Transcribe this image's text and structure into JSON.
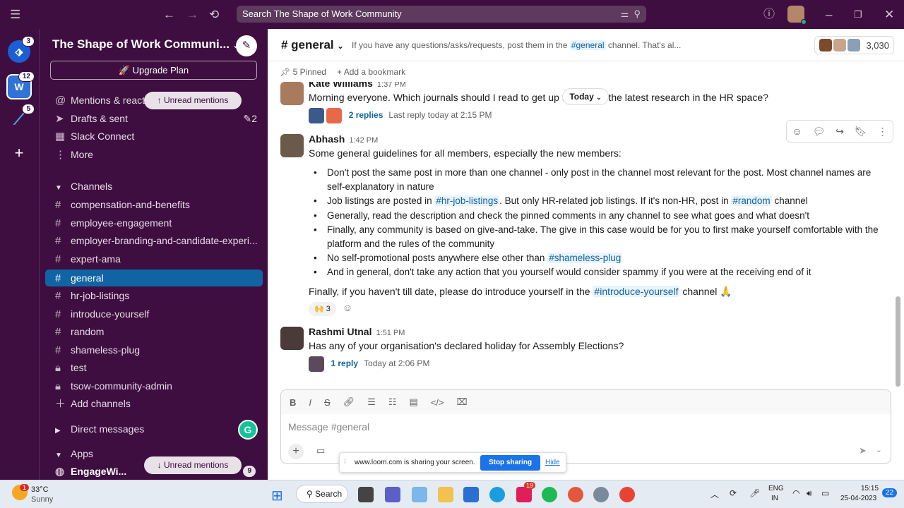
{
  "topbar": {
    "search_text": "Search The Shape of Work Community"
  },
  "workspace": {
    "name": "The Shape of Work Communi...",
    "upgrade": "Upgrade Plan"
  },
  "rail": {
    "badges": [
      "3",
      "12",
      "5"
    ]
  },
  "sidebar": {
    "nav": [
      {
        "label": "Mentions & reactions"
      },
      {
        "label": "Drafts & sent",
        "badge": "2"
      },
      {
        "label": "Slack Connect"
      },
      {
        "label": "More"
      }
    ],
    "unread_pill": "Unread mentions",
    "channels_header": "Channels",
    "channels": [
      "compensation-and-benefits",
      "employee-engagement",
      "employer-branding-and-candidate-experi...",
      "expert-ama",
      "general",
      "hr-job-listings",
      "introduce-yourself",
      "random",
      "shameless-plug",
      "test",
      "tsow-community-admin"
    ],
    "add_channels": "Add channels",
    "dms_header": "Direct messages",
    "apps_header": "Apps",
    "app_item": "EngageWi...",
    "app_badge": "9"
  },
  "channel": {
    "name": "# general",
    "topic_pre": "If you have any questions/asks/requests, post them in the",
    "topic_link": "#general",
    "topic_post": "channel. That's al...",
    "member_count": "3,030",
    "pinned": "5 Pinned",
    "bookmark": "Add a bookmark",
    "date_divider": "Today"
  },
  "messages": {
    "m1": {
      "author": "Kate Williams",
      "time": "1:37 PM",
      "text_a": "Morning everyone. Which journals should I read to get up to",
      "text_b": "the latest research in the HR space?",
      "replies": "2 replies",
      "last_reply": "Last reply today at 2:15 PM"
    },
    "m2": {
      "author": "Abhash",
      "time": "1:42 PM",
      "intro": "Some general guidelines for all members, especially the new members:",
      "b1": "Don't post the same post in more than one channel - only post in the channel most relevant for the post. Most channel names are self-explanatory in nature",
      "b2_pre": "Job listings are posted in",
      "b2_link": "#hr-job-listings",
      "b2_mid": ". But only HR-related job listings. If it's non-HR, post in",
      "b2_link2": "#random",
      "b2_post": "channel",
      "b3": " Generally, read the description and check the pinned comments in any channel to see what goes and what doesn't",
      "b4": " Finally, any community is based on give-and-take. The give in this case would be for you to first make yourself comfortable with the platform and the rules of the community",
      "b5_pre": "No self-promotional posts anywhere else other than",
      "b5_link": "#shameless-plug",
      "b6": "And in general, don't take any action that you yourself would consider spammy if you were at the receiving end of it",
      "outro_pre": "Finally, if you haven't till date, please do introduce yourself in the",
      "outro_link": "#introduce-yourself",
      "outro_post": "channel",
      "reaction_count": "3"
    },
    "m3": {
      "author": "Rashmi Utnal",
      "time": "1:51 PM",
      "text": "Has any of your organisation's declared holiday for Assembly Elections?",
      "replies": "1 reply",
      "last_reply": "Today at 2:06 PM"
    }
  },
  "composer": {
    "placeholder": "Message #general"
  },
  "loom": {
    "text": "www.loom.com is sharing your screen.",
    "stop": "Stop sharing",
    "hide": "Hide"
  },
  "taskbar": {
    "weather_temp": "33°C",
    "weather_desc": "Sunny",
    "weather_badge": "1",
    "search": "Search",
    "lang1": "ENG",
    "lang2": "IN",
    "time": "15:15",
    "date": "25-04-2023",
    "notif": "22",
    "slack_badge": "19"
  }
}
